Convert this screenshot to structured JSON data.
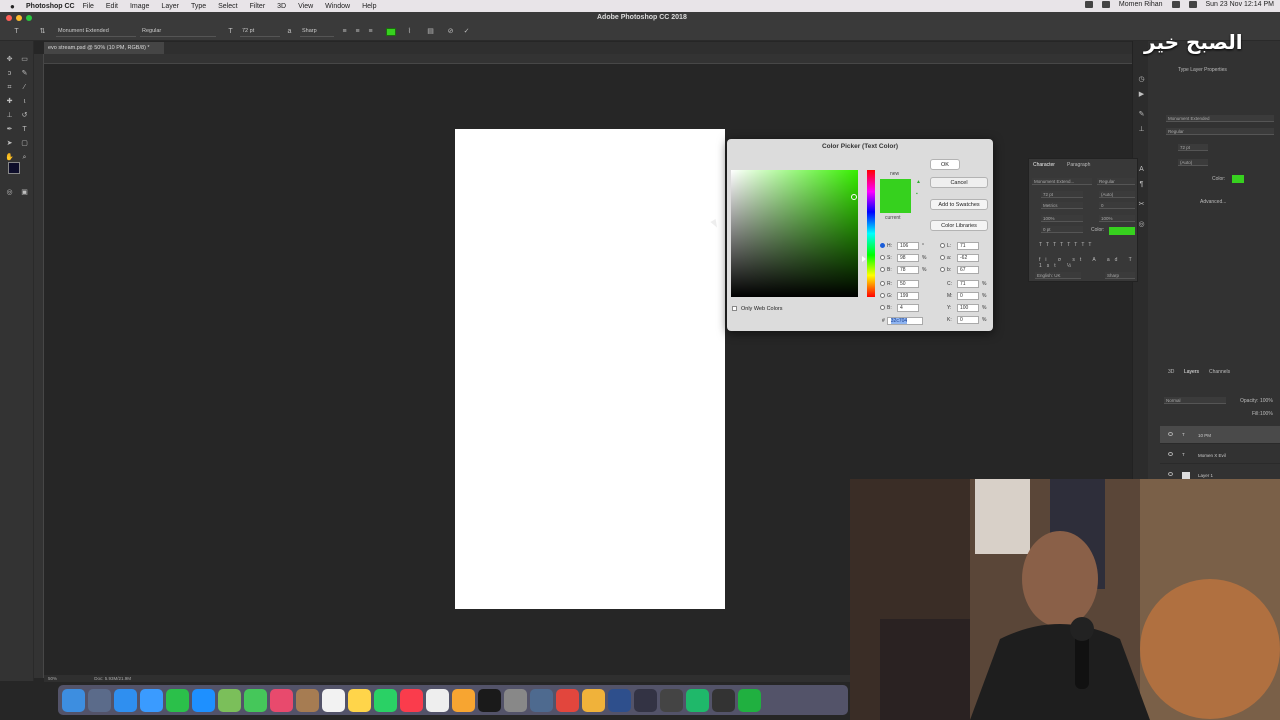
{
  "menubar": {
    "app": "Photoshop CC",
    "items": [
      "File",
      "Edit",
      "Image",
      "Layer",
      "Type",
      "Select",
      "Filter",
      "3D",
      "View",
      "Window",
      "Help"
    ],
    "center_title": "Adobe Photoshop CC 2018",
    "user": "Momen Rihan",
    "datetime": "Sun 23 Nov  12:14 PM"
  },
  "window": {
    "title": "Adobe Photoshop CC 2018"
  },
  "options_bar": {
    "font_family": "Monument Extended",
    "font_style": "Regular",
    "font_size": "72 pt",
    "antialias": "Sharp",
    "text_color": "#37d11f"
  },
  "document": {
    "tab": "evo stream.psd @ 50% (10 PM, RGB/8) *"
  },
  "status_bar": {
    "zoom": "50%",
    "doc_size": "Doc: 5.93M/21.9M"
  },
  "color_picker": {
    "title": "Color Picker (Text Color)",
    "new_label": "new",
    "current_label": "current",
    "ok": "OK",
    "cancel": "Cancel",
    "add_to_swatches": "Add to Swatches",
    "color_libraries": "Color Libraries",
    "only_web_colors": "Only Web Colors",
    "hsb": [
      {
        "label": "H:",
        "value": "106",
        "unit": "°"
      },
      {
        "label": "S:",
        "value": "98",
        "unit": "%"
      },
      {
        "label": "B:",
        "value": "78",
        "unit": "%"
      }
    ],
    "rgb": [
      {
        "label": "R:",
        "value": "50"
      },
      {
        "label": "G:",
        "value": "199"
      },
      {
        "label": "B:",
        "value": "4"
      }
    ],
    "lab": [
      {
        "label": "L:",
        "value": "71"
      },
      {
        "label": "a:",
        "value": "-62"
      },
      {
        "label": "b:",
        "value": "67"
      }
    ],
    "cmyk": [
      {
        "label": "C:",
        "value": "71",
        "unit": "%"
      },
      {
        "label": "M:",
        "value": "0",
        "unit": "%"
      },
      {
        "label": "Y:",
        "value": "100",
        "unit": "%"
      },
      {
        "label": "K:",
        "value": "0",
        "unit": "%"
      }
    ],
    "hex_label": "#",
    "hex": "32c704",
    "new_color": "#36d11e",
    "current_color": "#36d11e"
  },
  "character_panel": {
    "tabs": [
      "Character",
      "Paragraph"
    ],
    "font": "Monument Extend...",
    "style": "Regular",
    "size": "72 pt",
    "leading": "(Auto)",
    "kerning": "Metrics",
    "tracking": "0",
    "vscale": "100%",
    "hscale": "100%",
    "baseline": "0 pt",
    "color_label": "Color:",
    "language": "English: UK",
    "aa": "Sharp"
  },
  "properties_panel": {
    "title": "Type Layer Properties",
    "font": "Monument Extended",
    "style": "Regular",
    "size": "72 pt",
    "leading": "(Auto)",
    "color_label": "Color:",
    "advanced": "Advanced..."
  },
  "layers_panel": {
    "tabs": [
      "3D",
      "Layers",
      "Channels"
    ],
    "blend": "Normal",
    "opacity_label": "Opacity:",
    "opacity": "100%",
    "fill_label": "Fill:",
    "fill": "100%",
    "layers": [
      "10 PM",
      "Momen X Evil",
      "Layer 1"
    ]
  },
  "watermark": "الصبح خير"
}
